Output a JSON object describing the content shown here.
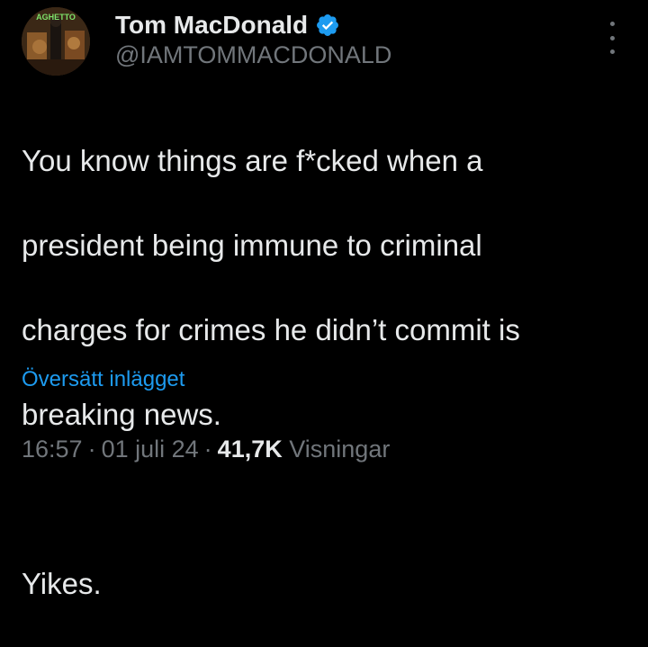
{
  "author": {
    "display_name": "Tom MacDonald",
    "handle": "@IAMTOMMACDONALD",
    "verified": true,
    "avatar_text": "AGHETTO",
    "avatar_icon": "profile-avatar"
  },
  "tweet": {
    "lines": [
      "You know things are f*cked when a",
      "president being immune to criminal",
      "charges for crimes he didn’t commit is",
      "breaking news."
    ],
    "closing": "Yikes."
  },
  "translate_label": "Översätt inlägget",
  "meta": {
    "time": "16:57",
    "date": "01 juli 24",
    "separator": "·",
    "views_count": "41,7K",
    "views_label": "Visningar"
  },
  "colors": {
    "background": "#000000",
    "text": "#e7e9ea",
    "secondary": "#71767b",
    "link": "#1d9bf0",
    "verified": "#1d9bf0"
  },
  "icons": {
    "verified": "verified-badge-icon",
    "more": "more-options-icon"
  }
}
